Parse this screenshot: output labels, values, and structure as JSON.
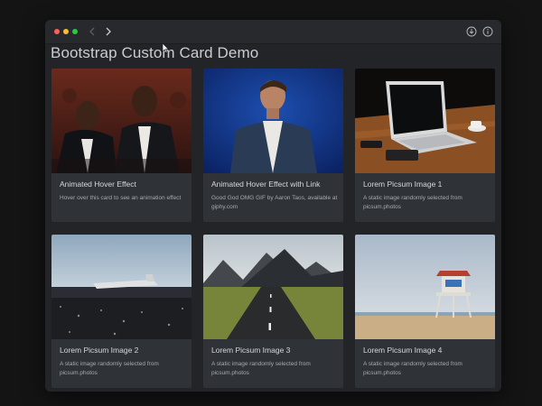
{
  "window": {
    "nav": {
      "back_icon": "chevron-left-icon",
      "forward_icon": "chevron-right-icon"
    },
    "toolbar_icons": [
      "download-icon",
      "info-icon"
    ]
  },
  "page": {
    "title": "Bootstrap Custom Card Demo"
  },
  "cards": [
    {
      "title": "Animated Hover Effect",
      "text": "Hover over this card to see an animation effect",
      "image": "movie-audience-photo"
    },
    {
      "title": "Animated Hover Effect with Link",
      "text": "Good God OMG GIF by Aaron Taos, available at giphy.com",
      "image": "man-in-denim-jacket-photo"
    },
    {
      "title": "Lorem Picsum Image 1",
      "text": "A static image randomly selected from picsum.photos",
      "image": "laptop-on-desk-photo"
    },
    {
      "title": "Lorem Picsum Image 2",
      "text": "A static image randomly selected from picsum.photos",
      "image": "plane-wreck-photo"
    },
    {
      "title": "Lorem Picsum Image 3",
      "text": "A static image randomly selected from picsum.photos",
      "image": "mountain-road-photo"
    },
    {
      "title": "Lorem Picsum Image 4",
      "text": "A static image randomly selected from picsum.photos",
      "image": "lifeguard-tower-photo"
    }
  ],
  "colors": {
    "window_bg": "#2a2d31",
    "card_bg": "#2f3237",
    "title_text": "#c9cdd2",
    "card_title": "#d5d8dc",
    "card_text": "#a6abb1"
  }
}
